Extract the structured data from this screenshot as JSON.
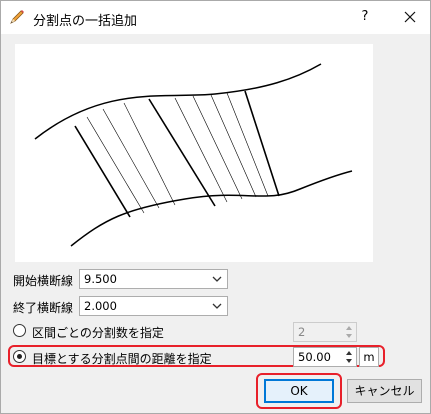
{
  "window": {
    "title": "分割点の一括追加",
    "help_label": "?",
    "close_icon": "close-icon",
    "title_icon": "pencil-icon"
  },
  "fields": {
    "start_section_label": "開始横断線",
    "start_section_value": "9.500",
    "end_section_label": "終了横断線",
    "end_section_value": "2.000"
  },
  "options": {
    "by_count_label": "区間ごとの分割数を指定",
    "by_count_value": "2",
    "by_count_selected": false,
    "by_distance_label": "目標とする分割点間の距離を指定",
    "by_distance_value": "50.00",
    "by_distance_unit": "m",
    "by_distance_selected": true
  },
  "buttons": {
    "ok_label": "OK",
    "cancel_label": "キャンセル"
  },
  "colors": {
    "highlight": "#e8202a",
    "default_button_border": "#0078d7"
  }
}
